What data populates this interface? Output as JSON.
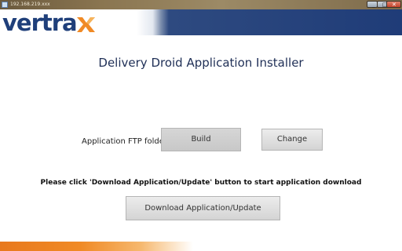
{
  "window": {
    "title": "192.168.219.xxx",
    "minimize_glyph": "_",
    "maximize_glyph": "□",
    "close_glyph": "✕"
  },
  "header": {
    "logo_text": "vertra",
    "brand_colors": {
      "navy": "#1f3f7a",
      "orange": "#f08a25"
    }
  },
  "main": {
    "title": "Delivery Droid Application Installer",
    "ftp_label": "Application FTP folder:",
    "build_button": "Build",
    "change_button": "Change",
    "instruction": "Please click 'Download Application/Update' button to start application download",
    "download_button": "Download Application/Update"
  },
  "icons": {
    "logo_x": "logo-x-icon",
    "window_app_icon": "app-icon"
  }
}
